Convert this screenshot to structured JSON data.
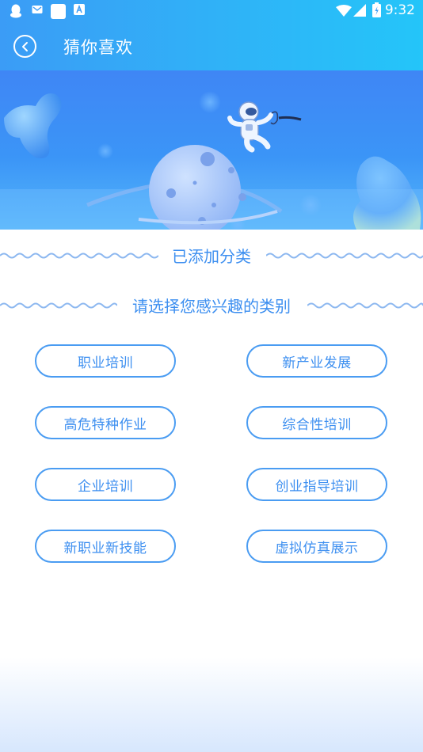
{
  "status_bar": {
    "time": "9:32",
    "left_icons": [
      "qq-icon",
      "mail-icon",
      "square-app-icon",
      "font-icon"
    ],
    "right_icons": [
      "wifi-icon",
      "signal-icon",
      "battery-icon"
    ]
  },
  "header": {
    "title": "猜你喜欢",
    "back_icon": "back-arrow-icon"
  },
  "banner": {
    "illustration": "astronaut-planet-illustration"
  },
  "sections": {
    "added": {
      "title": "已添加分类"
    },
    "choose": {
      "title": "请选择您感兴趣的类别"
    }
  },
  "categories": [
    {
      "label": "职业培训"
    },
    {
      "label": "新产业发展"
    },
    {
      "label": "高危特种作业"
    },
    {
      "label": "综合性培训"
    },
    {
      "label": "企业培训"
    },
    {
      "label": "创业指导培训"
    },
    {
      "label": "新职业新技能"
    },
    {
      "label": "虚拟仿真展示"
    }
  ],
  "colors": {
    "accent": "#3d8ff0",
    "header_start": "#3b9cf6",
    "header_end": "#24c5f9"
  }
}
